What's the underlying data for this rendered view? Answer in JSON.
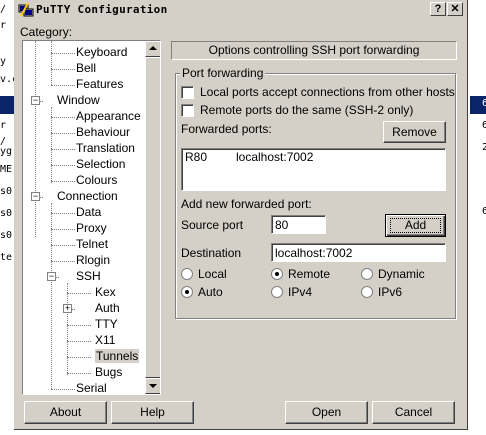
{
  "window": {
    "title": "PuTTY Configuration",
    "help_btn": "?",
    "close_btn": "✕"
  },
  "category_label": "Category:",
  "tree": [
    {
      "label": "Keyboard",
      "indent": 2
    },
    {
      "label": "Bell",
      "indent": 2
    },
    {
      "label": "Features",
      "indent": 2
    },
    {
      "label": "Window",
      "indent": 1,
      "expander": "−"
    },
    {
      "label": "Appearance",
      "indent": 2
    },
    {
      "label": "Behaviour",
      "indent": 2
    },
    {
      "label": "Translation",
      "indent": 2
    },
    {
      "label": "Selection",
      "indent": 2
    },
    {
      "label": "Colours",
      "indent": 2
    },
    {
      "label": "Connection",
      "indent": 1,
      "expander": "−"
    },
    {
      "label": "Data",
      "indent": 2
    },
    {
      "label": "Proxy",
      "indent": 2
    },
    {
      "label": "Telnet",
      "indent": 2
    },
    {
      "label": "Rlogin",
      "indent": 2
    },
    {
      "label": "SSH",
      "indent": 2,
      "expander": "−"
    },
    {
      "label": "Kex",
      "indent": 3
    },
    {
      "label": "Auth",
      "indent": 3,
      "expander": "+"
    },
    {
      "label": "TTY",
      "indent": 3
    },
    {
      "label": "X11",
      "indent": 3
    },
    {
      "label": "Tunnels",
      "indent": 3,
      "selected": true
    },
    {
      "label": "Bugs",
      "indent": 3
    },
    {
      "label": "Serial",
      "indent": 2
    }
  ],
  "panel": {
    "header": "Options controlling SSH port forwarding",
    "group_title": "Port forwarding",
    "local_ports_label": "Local ports accept connections from other hosts",
    "local_ports_checked": false,
    "remote_ports_label": "Remote ports do the same (SSH-2 only)",
    "remote_ports_checked": false,
    "forwarded_ports_label": "Forwarded ports:",
    "remove_btn": "Remove",
    "forwarded_list": [
      {
        "port": "R80",
        "dest": "localhost:7002"
      }
    ],
    "add_new_label": "Add new forwarded port:",
    "source_port_label": "Source port",
    "source_port_value": "80",
    "add_btn": "Add",
    "destination_label": "Destination",
    "destination_value": "localhost:7002",
    "type_options": [
      {
        "label": "Local",
        "selected": false
      },
      {
        "label": "Remote",
        "selected": true
      },
      {
        "label": "Dynamic",
        "selected": false
      }
    ],
    "ip_options": [
      {
        "label": "Auto",
        "selected": true
      },
      {
        "label": "IPv4",
        "selected": false
      },
      {
        "label": "IPv6",
        "selected": false
      }
    ]
  },
  "buttons": {
    "about": "About",
    "help": "Help",
    "open": "Open",
    "cancel": "Cancel"
  },
  "background": {
    "left_fragments": [
      "/",
      "r",
      "y",
      "v.c",
      "y",
      "r",
      "/",
      "yg",
      "ME",
      "s0",
      "s0",
      "s0",
      "te"
    ],
    "right_fragments": [
      "6",
      "6",
      "2",
      "6"
    ]
  }
}
